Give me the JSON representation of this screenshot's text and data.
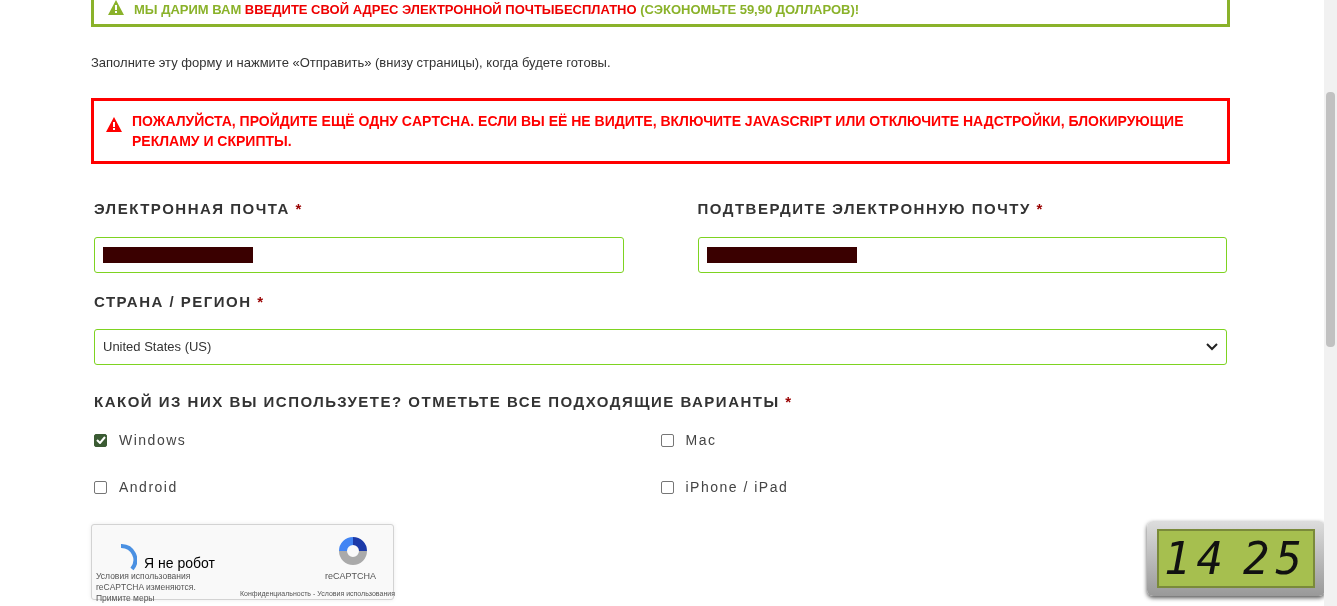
{
  "promo_banner": {
    "lead": "МЫ ДАРИМ ВАМ",
    "highlight": "ВВЕДИТЕ СВОЙ АДРЕС ЭЛЕКТРОННОЙ ПОЧТЫБЕСПЛАТНО",
    "tail": "(СЭКОНОМЬТЕ 59,90 ДОЛЛАРОВ)!"
  },
  "intro": "Заполните эту форму и нажмите «Отправить» (внизу страницы), когда будете готовы.",
  "error_alert": "ПОЖАЛУЙСТА, ПРОЙДИТЕ ЕЩЁ ОДНУ CAPTCHA. ЕСЛИ ВЫ ЕЁ НЕ ВИДИТЕ, ВКЛЮЧИТЕ JAVASCRIPT ИЛИ ОТКЛЮЧИТЕ НАДСТРОЙКИ, БЛОКИРУЮЩИЕ РЕКЛАМУ И СКРИПТЫ.",
  "fields": [
    {
      "label": "ЭЛЕКТРОННАЯ ПОЧТА",
      "required_mark": "*",
      "redacted": true
    },
    {
      "label": "ПОДТВЕРДИТЕ ЭЛЕКТРОННУЮ ПОЧТУ",
      "required_mark": "*",
      "redacted": true
    }
  ],
  "country": {
    "label": "СТРАНА / РЕГИОН",
    "required_mark": "*",
    "value": "United States (US)"
  },
  "platforms": {
    "label": "КАКОЙ ИЗ НИХ ВЫ ИСПОЛЬЗУЕТЕ? ОТМЕТЬТЕ ВСЕ ПОДХОДЯЩИЕ ВАРИАНТЫ",
    "required_mark": "*",
    "options": [
      {
        "label": "Windows",
        "checked": true
      },
      {
        "label": "Mac",
        "checked": false
      },
      {
        "label": "Android",
        "checked": false
      },
      {
        "label": "iPhone / iPad",
        "checked": false
      }
    ]
  },
  "captcha": {
    "label": "Я не робот",
    "brand": "reCAPTCHA",
    "notice": "Условия использования reCAPTCHA изменяются.",
    "notice_link": "Примите меры",
    "footer_links": [
      "Конфиденциальность",
      "Условия использования"
    ],
    "separator": "-"
  },
  "clock": {
    "hours": "14",
    "minutes": "25"
  }
}
